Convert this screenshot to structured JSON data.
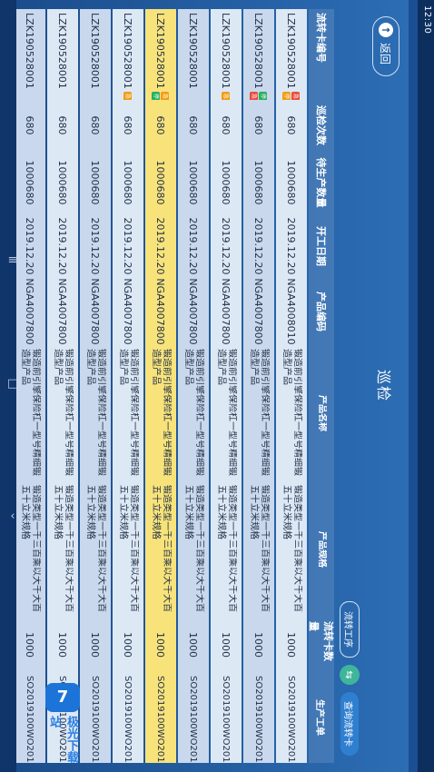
{
  "status_bar": {
    "time": "12:30"
  },
  "nav_bar": {
    "recents_icon": "≡",
    "home_icon": "□",
    "back_icon": "‹"
  },
  "header": {
    "back_label": "返回",
    "back_icon": "arrow-up",
    "title": "巡检"
  },
  "controls": {
    "process_label": "流转工序",
    "toggle_icon": "⇆",
    "query_label": "查询流转卡"
  },
  "table": {
    "columns": [
      "流转卡编号",
      "巡检次数",
      "待生产数量",
      "开工日期",
      "产品编码",
      "产品名称",
      "产品规格",
      "流转卡数量",
      "生产工单"
    ],
    "rows": [
      {
        "card": "LZK190528001",
        "tags": [
          "急",
          "停"
        ],
        "tag_colors": [
          "#e74c3c",
          "#f39c12"
        ],
        "count": "680",
        "pending": "1000680",
        "date": "2019.12.20",
        "code": "NGA4008010",
        "name": "锻造前引擎保险杠一型号精细锻造型产品",
        "spec": "锻造类型一千三百乘以大千大百五十立米规格",
        "qty": "1000",
        "order": "SO2019100WO20191120",
        "style": "normal"
      },
      {
        "card": "LZK190528001",
        "tags": [
          "停",
          "急"
        ],
        "tag_colors": [
          "#27ae60",
          "#e74c3c"
        ],
        "count": "680",
        "pending": "1000680",
        "date": "2019.12.20",
        "code": "NGA4007800",
        "name": "锻造前引擎保险杠一型号精细锻造型产品",
        "spec": "锻造类型一千三百乘以大千大百五十立米规格",
        "qty": "1000",
        "order": "SO2019100WO20191120",
        "style": "alt"
      },
      {
        "card": "LZK190528001",
        "tags": [
          "急"
        ],
        "tag_colors": [
          "#f39c12"
        ],
        "count": "680",
        "pending": "1000680",
        "date": "2019.12.20",
        "code": "NGA4007800",
        "name": "锻造前引擎保险杠一型号精细锻造型产品",
        "spec": "锻造类型一千三百乘以大千大百五十立米规格",
        "qty": "1000",
        "order": "SO2019100WO20191120",
        "style": "normal"
      },
      {
        "card": "LZK190528001",
        "tags": [],
        "tag_colors": [],
        "count": "680",
        "pending": "1000680",
        "date": "2019.12.20",
        "code": "NGA4007800",
        "name": "锻造前引擎保险杠一型号精细锻造型产品",
        "spec": "锻造类型一千三百乘以大千大百五十立米规格",
        "qty": "1000",
        "order": "SO2019100WO20191120",
        "style": "alt"
      },
      {
        "card": "LZK190528001",
        "tags": [
          "急",
          "停"
        ],
        "tag_colors": [
          "#f39c12",
          "#27ae60"
        ],
        "count": "680",
        "pending": "1000680",
        "date": "2019.12.20",
        "code": "NGA4007800",
        "name": "锻造前引擎保险杠一型号精细锻造型产品",
        "spec": "锻造类型一千三百乘以大千大百五十立米规格",
        "qty": "1000",
        "order": "SO2019100WO20191120",
        "style": "hl"
      },
      {
        "card": "LZK190528001",
        "tags": [
          "急"
        ],
        "tag_colors": [
          "#f39c12"
        ],
        "count": "680",
        "pending": "1000680",
        "date": "2019.12.20",
        "code": "NGA4007800",
        "name": "锻造前引擎保险杠一型号精细锻造型产品",
        "spec": "锻造类型一千三百乘以大千大百五十立米规格",
        "qty": "1000",
        "order": "SO2019100WO20191120",
        "style": "normal"
      },
      {
        "card": "LZK190528001",
        "tags": [],
        "tag_colors": [],
        "count": "680",
        "pending": "1000680",
        "date": "2019.12.20",
        "code": "NGA4007800",
        "name": "锻造前引擎保险杠一型号精细锻造型产品",
        "spec": "锻造类型一千三百乘以大千大百五十立米规格",
        "qty": "1000",
        "order": "SO2019100WO20191120",
        "style": "alt"
      },
      {
        "card": "LZK190528001",
        "tags": [],
        "tag_colors": [],
        "count": "680",
        "pending": "1000680",
        "date": "2019.12.20",
        "code": "NGA4007800",
        "name": "锻造前引擎保险杠一型号精细锻造型产品",
        "spec": "锻造类型一千三百乘以大千大百五十立米规格",
        "qty": "1000",
        "order": "SO2019100WO20191120",
        "style": "normal"
      },
      {
        "card": "LZK190528001",
        "tags": [],
        "tag_colors": [],
        "count": "680",
        "pending": "1000680",
        "date": "2019.12.20",
        "code": "NGA4007800",
        "name": "锻造前引擎保险杠一型号精细锻造型产品",
        "spec": "锻造类型一千三百乘以大千大百五十立米规格",
        "qty": "1000",
        "order": "SO2019100WO20191120",
        "style": "alt"
      }
    ]
  },
  "watermark": {
    "logo_text": "7",
    "name": "极光下载站"
  },
  "colors": {
    "accent": "#1b4d8d",
    "highlight_row": "#f8e37b",
    "row": "#dde8f5",
    "row_alt": "#c9d8ec"
  }
}
